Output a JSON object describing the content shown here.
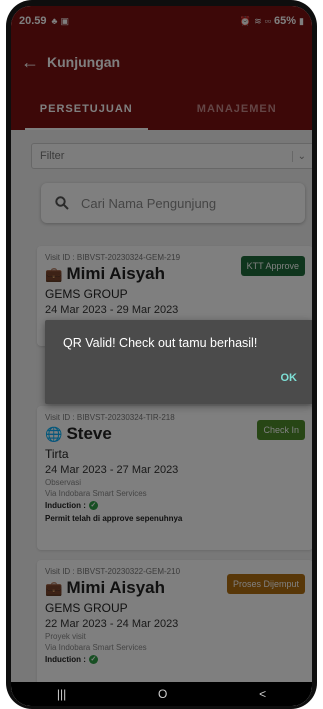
{
  "status_bar": {
    "time": "20.59",
    "battery": "65%"
  },
  "app_bar": {
    "title": "Kunjungan"
  },
  "tabs": [
    {
      "label": "PERSETUJUAN",
      "active": true
    },
    {
      "label": "MANAJEMEN",
      "active": false
    }
  ],
  "filter": {
    "placeholder": "Filter"
  },
  "search": {
    "placeholder": "Cari Nama Pengunjung"
  },
  "cards": [
    {
      "visit_id": "Visit ID : BIBVST-20230324-GEM-219",
      "name": "Mimi Aisyah",
      "icon": "briefcase-icon",
      "company": "GEMS GROUP",
      "date": "24 Mar 2023 - 29 Mar 2023",
      "badge": "KTT Approve",
      "badge_color": "#1e6b3a"
    },
    {
      "visit_id": "Visit ID : BIBVST-20230324-TIR-218",
      "name": "Steve",
      "icon": "globe-icon",
      "company": "Tirta",
      "date": "24 Mar 2023 - 27 Mar 2023",
      "purpose": "Observasi",
      "via": "Via Indobara Smart Services",
      "induction": "Induction :",
      "permit": "Permit telah di approve sepenuhnya",
      "badge": "Check In",
      "badge_color": "#4e8c2b"
    },
    {
      "visit_id": "Visit ID : BIBVST-20230322-GEM-210",
      "name": "Mimi Aisyah",
      "icon": "briefcase-icon",
      "company": "GEMS GROUP",
      "date": "22 Mar 2023 - 24 Mar 2023",
      "purpose": "Proyek visit",
      "via": "Via Indobara Smart Services",
      "induction": "Induction :",
      "badge": "Proses Dijemput",
      "badge_color": "#b06e10"
    }
  ],
  "dialog": {
    "message": "QR Valid! Check out tamu berhasil!",
    "ok_label": "OK"
  },
  "nav_bar": {
    "recents": "|||",
    "home": "O",
    "back": "<"
  }
}
